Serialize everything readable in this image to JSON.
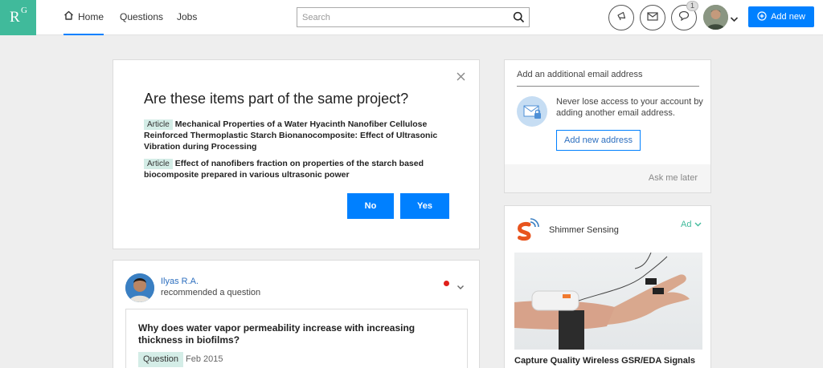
{
  "header": {
    "logo_r": "R",
    "logo_g": "G",
    "nav": {
      "home": "Home",
      "questions": "Questions",
      "jobs": "Jobs"
    },
    "search_placeholder": "Search",
    "notification_count": "1",
    "add_new_label": "Add new"
  },
  "project_card": {
    "title": "Are these items part of the same project?",
    "items": [
      {
        "tag": "Article",
        "title": "Mechanical Properties of a Water Hyacinth Nanofiber Cellulose Reinforced Thermoplastic Starch Bionanocomposite: Effect of Ultrasonic Vibration during Processing"
      },
      {
        "tag": "Article",
        "title": "Effect of nanofibers fraction on properties of the starch based biocomposite prepared in various ultrasonic power"
      }
    ],
    "no_label": "No",
    "yes_label": "Yes"
  },
  "feed_card": {
    "author": "Ilyas R.A.",
    "action": "recommended a question",
    "question_title": "Why does water vapor permeability increase with increasing thickness in biofilms?",
    "question_tag": "Question",
    "question_date": "Feb 2015"
  },
  "email_card": {
    "title": "Add an additional email address",
    "text": "Never lose access to your account by adding another email address.",
    "button_label": "Add new address",
    "ask_later": "Ask me later"
  },
  "ad_card": {
    "advertiser": "Shimmer Sensing",
    "ad_label": "Ad",
    "caption": "Capture Quality Wireless GSR/EDA Signals"
  },
  "colors": {
    "brand_green": "#40ba9b",
    "primary_blue": "#0080ff",
    "notification_red": "#e0201b"
  }
}
